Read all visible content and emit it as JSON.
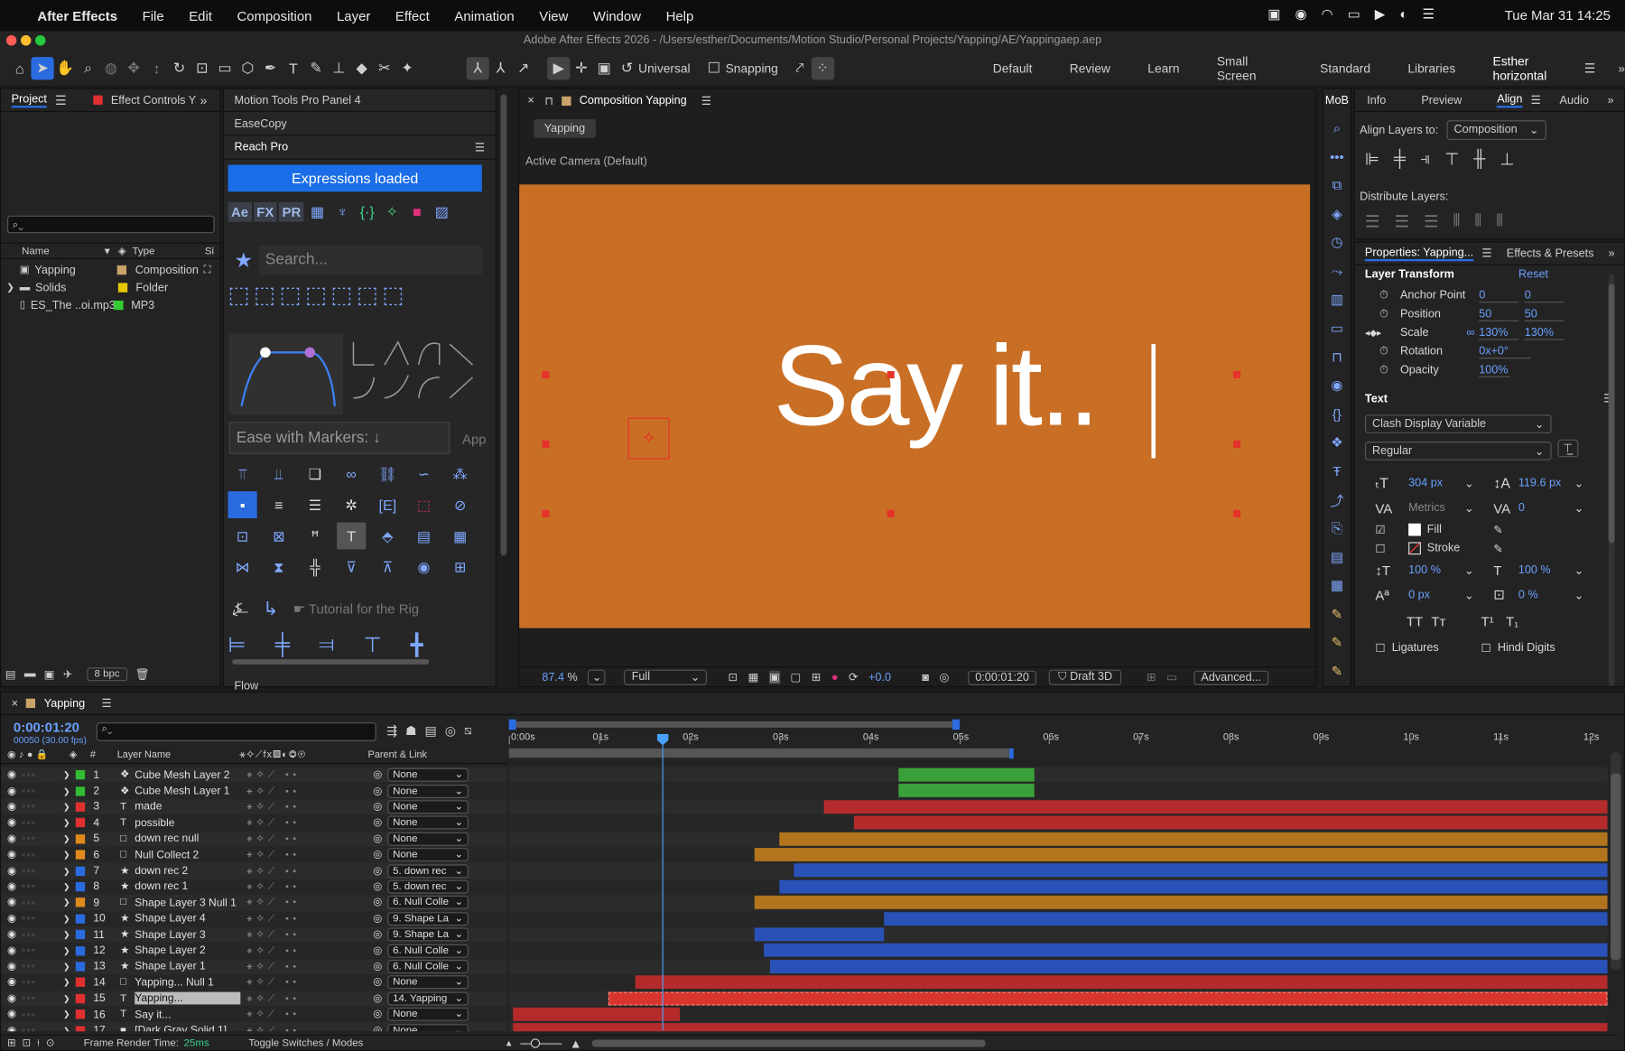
{
  "menubar": {
    "app": "After Effects",
    "items": [
      "File",
      "Edit",
      "Composition",
      "Layer",
      "Effect",
      "Animation",
      "View",
      "Window",
      "Help"
    ],
    "clock": "Tue Mar 31  14:25"
  },
  "title": "Adobe After Effects 2026 - /Users/esther/Documents/Motion Studio/Personal Projects/Yapping/AE/Yappingaep.aep",
  "toolbar": {
    "universal": "Universal",
    "snapping": "Snapping",
    "workspaces": [
      "Default",
      "Review",
      "Learn",
      "Small Screen",
      "Standard",
      "Libraries",
      "Esther horizontal"
    ]
  },
  "project": {
    "tab": "Project",
    "tab2": "Effect Controls Ya",
    "cols": [
      "Name",
      "Type",
      "Si"
    ],
    "items": [
      {
        "name": "Yapping",
        "type": "Composition",
        "color": "#c9a36a"
      },
      {
        "name": "Solids",
        "type": "Folder",
        "color": "#e6c700"
      },
      {
        "name": "ES_The ..oi.mp3",
        "type": "MP3",
        "color": "#33cc33"
      }
    ],
    "bpc": "8 bpc"
  },
  "plugins": {
    "motion_tools": "Motion Tools Pro Panel 4",
    "easecopy": "EaseCopy",
    "reach": "Reach Pro",
    "expr": "Expressions loaded",
    "search": "Search...",
    "ease": "Ease with Markers: ↓",
    "app": "App",
    "tutorial": "☛ Tutorial for the Rig",
    "flow": "Flow",
    "tabs": [
      "Ae",
      "FX",
      "PR"
    ]
  },
  "comp": {
    "tab": "Composition Yapping",
    "pill": "Yapping",
    "camera": "Active Camera (Default)",
    "text": "Say it..",
    "zoom": "87.4",
    "zoom_unit": "%",
    "res": "Full",
    "exposure": "+0.0",
    "time": "0:00:01:20",
    "draft": "Draft 3D",
    "adv": "Advanced..."
  },
  "right": {
    "tabs": [
      "MoB",
      "Info",
      "Preview",
      "Align",
      "Audio"
    ],
    "align_to_label": "Align Layers to:",
    "align_to": "Composition",
    "distribute": "Distribute Layers:",
    "props_tab": "Properties: Yapping...",
    "fx_tab": "Effects & Presets",
    "transform": "Layer Transform",
    "reset": "Reset",
    "rows": [
      {
        "n": "Anchor Point",
        "a": "0",
        "b": "0"
      },
      {
        "n": "Position",
        "a": "50",
        "b": "50"
      },
      {
        "n": "Scale",
        "a": "130%",
        "b": "130%"
      },
      {
        "n": "Rotation",
        "a": "0x+0°",
        "b": ""
      },
      {
        "n": "Opacity",
        "a": "100%",
        "b": ""
      }
    ],
    "text": "Text",
    "font": "Clash Display Variable",
    "style": "Regular",
    "size": "304 px",
    "leading": "119.6 px",
    "kern": "Metrics",
    "track": "0",
    "fill": "Fill",
    "stroke": "Stroke",
    "vscale": "100 %",
    "hscale": "100 %",
    "baseline": "0 px",
    "tsume": "0 %",
    "ligatures": "Ligatures",
    "hindi": "Hindi Digits",
    "caps": [
      "TT",
      "Tт",
      "T¹",
      "T₁"
    ]
  },
  "timeline": {
    "tab": "Yapping",
    "time": "0:00:01:20",
    "frames": "00050 (30.00 fps)",
    "col_name": "Layer Name",
    "col_parent": "Parent & Link",
    "render": "Frame Render Time:",
    "render_val": "25ms",
    "toggle": "Toggle Switches / Modes",
    "ruler": [
      "0:00s",
      "01s",
      "02s",
      "03s",
      "04s",
      "05s",
      "06s",
      "07s",
      "08s",
      "09s",
      "10s",
      "11s",
      "12s"
    ],
    "layers": [
      {
        "n": "1",
        "name": "Cube Mesh Layer 2",
        "ic": "❖",
        "c": "#33bb33",
        "p": "None",
        "bs": 4.33,
        "be": 5.83,
        "bc": "#3aa13a"
      },
      {
        "n": "2",
        "name": "Cube Mesh Layer 1",
        "ic": "❖",
        "c": "#33bb33",
        "p": "None",
        "bs": 4.33,
        "be": 5.83,
        "bc": "#3aa13a"
      },
      {
        "n": "3",
        "name": "made",
        "ic": "T",
        "c": "#e03030",
        "p": "None",
        "bs": 3.5,
        "be": 12.2,
        "bc": "#b52b2b"
      },
      {
        "n": "4",
        "name": "possible",
        "ic": "T",
        "c": "#e03030",
        "p": "None",
        "bs": 3.83,
        "be": 12.2,
        "bc": "#b52b2b"
      },
      {
        "n": "5",
        "name": "down rec null",
        "ic": "□",
        "c": "#e08a1e",
        "p": "None",
        "bs": 3.0,
        "be": 12.2,
        "bc": "#b3741e"
      },
      {
        "n": "6",
        "name": "Null Collect 2",
        "ic": "□",
        "c": "#e08a1e",
        "p": "None",
        "bs": 2.73,
        "be": 12.2,
        "bc": "#b3741e"
      },
      {
        "n": "7",
        "name": "down rec 2",
        "ic": "★",
        "c": "#2a6be0",
        "p": "5. down rec",
        "bs": 3.17,
        "be": 12.2,
        "bc": "#2952b8"
      },
      {
        "n": "8",
        "name": "down rec 1",
        "ic": "★",
        "c": "#2a6be0",
        "p": "5. down rec",
        "bs": 3.0,
        "be": 12.2,
        "bc": "#2952b8"
      },
      {
        "n": "9",
        "name": "Shape Layer 3 Null 1",
        "ic": "□",
        "c": "#e08a1e",
        "p": "6. Null Colle",
        "bs": 2.73,
        "be": 12.2,
        "bc": "#b3741e"
      },
      {
        "n": "10",
        "name": "Shape Layer 4",
        "ic": "★",
        "c": "#2a6be0",
        "p": "9. Shape La",
        "bs": 4.17,
        "be": 12.2,
        "bc": "#2952b8"
      },
      {
        "n": "11",
        "name": "Shape Layer 3",
        "ic": "★",
        "c": "#2a6be0",
        "p": "9. Shape La",
        "bs": 2.73,
        "be": 4.17,
        "bc": "#2952b8"
      },
      {
        "n": "12",
        "name": "Shape Layer 2",
        "ic": "★",
        "c": "#2a6be0",
        "p": "6. Null Colle",
        "bs": 2.83,
        "be": 12.2,
        "bc": "#2952b8"
      },
      {
        "n": "13",
        "name": "Shape Layer 1",
        "ic": "★",
        "c": "#2a6be0",
        "p": "6. Null Colle",
        "bs": 2.9,
        "be": 12.2,
        "bc": "#2952b8"
      },
      {
        "n": "14",
        "name": "Yapping... Null 1",
        "ic": "□",
        "c": "#e03030",
        "p": "None",
        "bs": 1.4,
        "be": 12.2,
        "bc": "#b52b2b"
      },
      {
        "n": "15",
        "name": "Yapping...",
        "ic": "T",
        "c": "#e03030",
        "p": "14. Yapping",
        "bs": 1.1,
        "be": 12.2,
        "bc": "#d8352f"
      },
      {
        "n": "16",
        "name": "Say it...",
        "ic": "T",
        "c": "#e03030",
        "p": "None",
        "bs": 0.05,
        "be": 1.9,
        "bc": "#b52b2b"
      },
      {
        "n": "17",
        "name": "[Dark Gray Solid 1]",
        "ic": "■",
        "c": "#e03030",
        "p": "None",
        "bs": 0.05,
        "be": 12.2,
        "bc": "#b52b2b"
      }
    ]
  }
}
